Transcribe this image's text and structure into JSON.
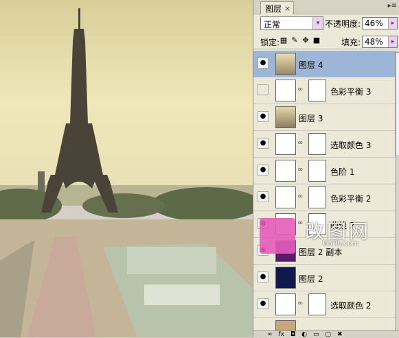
{
  "panel": {
    "tab_label": "图层",
    "tab_close": "×",
    "blend_mode": "正常",
    "opacity_label": "不透明度:",
    "opacity_value": "46%",
    "lock_label": "锁定:",
    "fill_label": "填充:",
    "fill_value": "48%"
  },
  "layers": [
    {
      "name": "图层 4",
      "visible": true,
      "selected": true,
      "kind": "pixel"
    },
    {
      "name": "色彩平衡 3",
      "visible": false,
      "selected": false,
      "kind": "adjustment"
    },
    {
      "name": "图层 3",
      "visible": true,
      "selected": false,
      "kind": "pixel"
    },
    {
      "name": "选取颜色 3",
      "visible": true,
      "selected": false,
      "kind": "adjustment"
    },
    {
      "name": "色阶 1",
      "visible": true,
      "selected": false,
      "kind": "adjustment"
    },
    {
      "name": "色彩平衡 2",
      "visible": true,
      "selected": false,
      "kind": "adjustment"
    },
    {
      "name": "曲线 2",
      "visible": true,
      "selected": false,
      "kind": "adjustment"
    },
    {
      "name": "图层 2 副本",
      "visible": true,
      "selected": false,
      "kind": "pixel"
    },
    {
      "name": "图层 2",
      "visible": true,
      "selected": false,
      "kind": "pixel"
    },
    {
      "name": "选取颜色 2",
      "visible": true,
      "selected": false,
      "kind": "adjustment"
    }
  ],
  "watermark": {
    "text": "改图网",
    "url": "GaiTu.com"
  },
  "icons": {
    "eye": "eye-icon",
    "chain": "chain-link-icon",
    "menu": "panel-menu-icon",
    "lock_transparent": "lock-transparent-icon",
    "lock_paint": "lock-paint-icon",
    "lock_move": "lock-move-icon",
    "lock_all": "lock-all-icon"
  },
  "colors": {
    "selected_row": "#9db6d8",
    "sky": "#e9e0b1",
    "ground": "#b0a188"
  }
}
